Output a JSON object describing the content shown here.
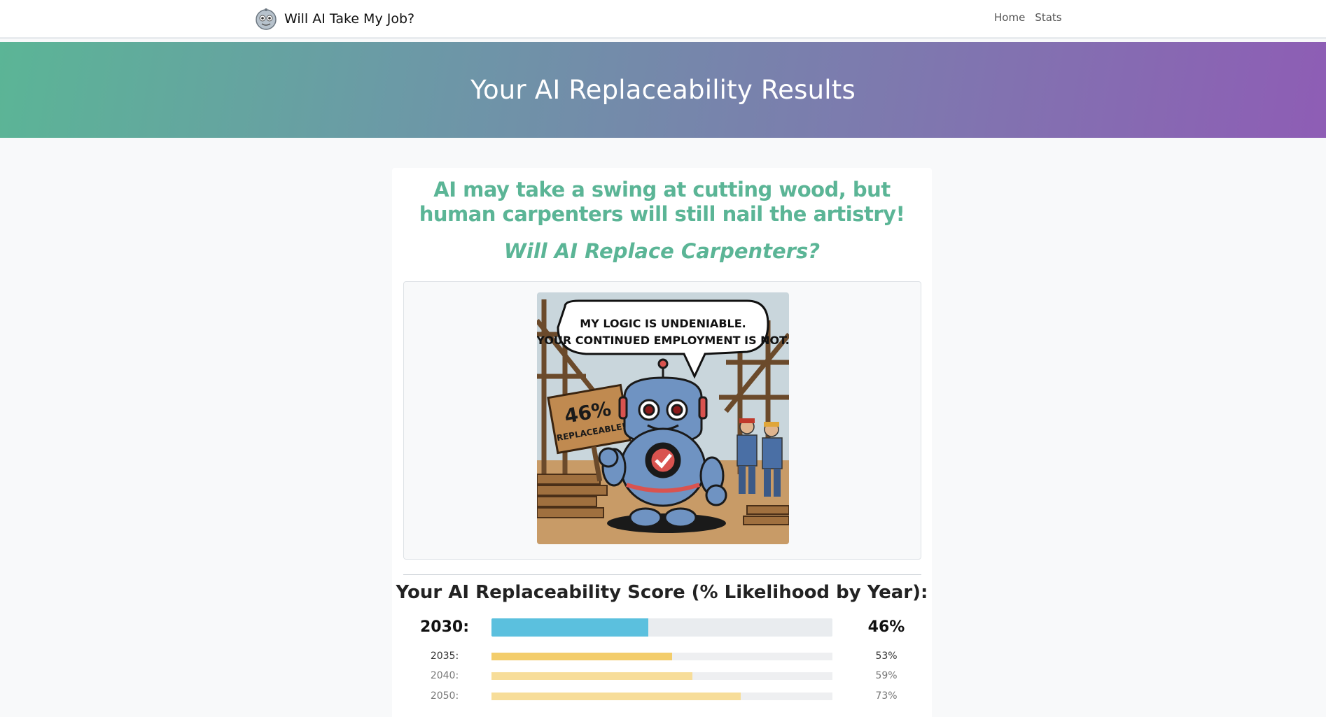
{
  "nav": {
    "brand": "Will AI Take My Job?",
    "links": [
      "Home",
      "Stats"
    ]
  },
  "hero": {
    "title": "Your AI Replaceability Results"
  },
  "card": {
    "headline": "AI may take a swing at cutting wood, but human carpenters will still nail the artistry!",
    "subhead": "Will AI Replace Carpenters?",
    "illustration": {
      "speech_line1": "MY LOGIC IS UNDENIABLE.",
      "speech_line2": "YOUR CONTINUED EMPLOYMENT IS NOT.",
      "sign_pct": "46%",
      "sign_text": "REPLACEABLE!"
    },
    "score_title": "Your AI Replaceability Score (% Likelihood by Year):",
    "scores": [
      {
        "year": "2030:",
        "value": 46,
        "label": "46%"
      },
      {
        "year": "2035:",
        "value": 53,
        "label": "53%"
      },
      {
        "year": "2040:",
        "value": 59,
        "label": "59%"
      },
      {
        "year": "2050:",
        "value": 73,
        "label": "73%"
      }
    ]
  },
  "colors": {
    "accent_green": "#5bb596",
    "gradient_end_purple": "#8e5db5",
    "bar_main": "#5bc0de",
    "bar_future": "#f3cd6b"
  },
  "icons": {
    "brand_logo": "robot-face-icon",
    "illustration_badge": "checkmark-icon"
  }
}
